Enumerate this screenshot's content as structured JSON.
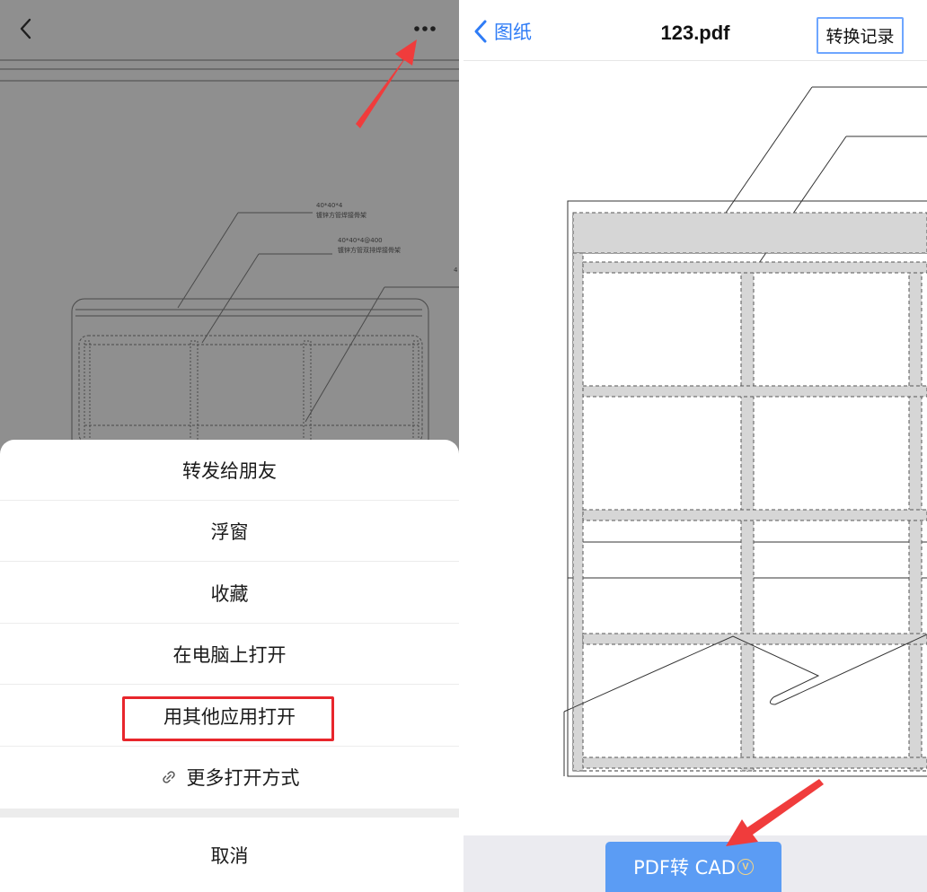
{
  "left_panel": {
    "drawing_labels": {
      "label_1_dim": "40*40*4",
      "label_1_text": "镀锌方管焊接骨架",
      "label_2_dim": "40*40*4@400",
      "label_2_text": "镀锌方管双排焊接骨架",
      "label_3_dim": "4"
    },
    "action_sheet": {
      "items": [
        {
          "label": "转发给朋友"
        },
        {
          "label": "浮窗"
        },
        {
          "label": "收藏"
        },
        {
          "label": "在电脑上打开"
        },
        {
          "label": "用其他应用打开",
          "highlighted": true
        },
        {
          "label": "更多打开方式",
          "icon": "link-icon"
        }
      ],
      "cancel_label": "取消"
    },
    "icons": {
      "back": "chevron-left-icon",
      "more": "more-dots-icon"
    }
  },
  "right_panel": {
    "nav": {
      "back_label": "图纸",
      "title": "123.pdf",
      "history_button": "转换记录"
    },
    "convert_button": {
      "label": "PDF转 CAD",
      "badge": "V"
    },
    "colors": {
      "accent": "#2f7cf6",
      "button": "#5b9cf4",
      "highlight": "#e8262c",
      "annotation_arrow": "#f03c3c"
    }
  }
}
